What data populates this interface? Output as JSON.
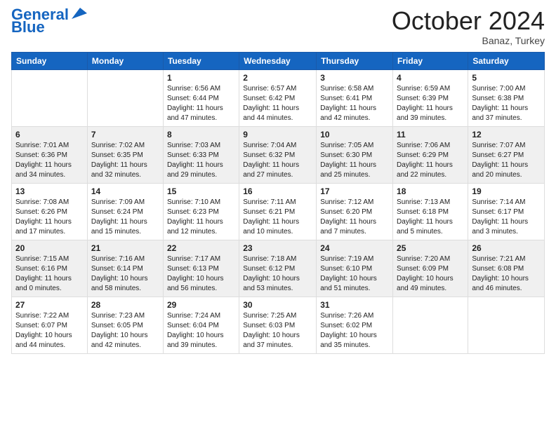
{
  "logo": {
    "line1": "General",
    "line2": "Blue"
  },
  "header": {
    "month": "October 2024",
    "location": "Banaz, Turkey"
  },
  "days_of_week": [
    "Sunday",
    "Monday",
    "Tuesday",
    "Wednesday",
    "Thursday",
    "Friday",
    "Saturday"
  ],
  "weeks": [
    [
      null,
      null,
      {
        "day": 1,
        "sunrise": "6:56 AM",
        "sunset": "6:44 PM",
        "daylight": "11 hours and 47 minutes."
      },
      {
        "day": 2,
        "sunrise": "6:57 AM",
        "sunset": "6:42 PM",
        "daylight": "11 hours and 44 minutes."
      },
      {
        "day": 3,
        "sunrise": "6:58 AM",
        "sunset": "6:41 PM",
        "daylight": "11 hours and 42 minutes."
      },
      {
        "day": 4,
        "sunrise": "6:59 AM",
        "sunset": "6:39 PM",
        "daylight": "11 hours and 39 minutes."
      },
      {
        "day": 5,
        "sunrise": "7:00 AM",
        "sunset": "6:38 PM",
        "daylight": "11 hours and 37 minutes."
      }
    ],
    [
      {
        "day": 6,
        "sunrise": "7:01 AM",
        "sunset": "6:36 PM",
        "daylight": "11 hours and 34 minutes."
      },
      {
        "day": 7,
        "sunrise": "7:02 AM",
        "sunset": "6:35 PM",
        "daylight": "11 hours and 32 minutes."
      },
      {
        "day": 8,
        "sunrise": "7:03 AM",
        "sunset": "6:33 PM",
        "daylight": "11 hours and 29 minutes."
      },
      {
        "day": 9,
        "sunrise": "7:04 AM",
        "sunset": "6:32 PM",
        "daylight": "11 hours and 27 minutes."
      },
      {
        "day": 10,
        "sunrise": "7:05 AM",
        "sunset": "6:30 PM",
        "daylight": "11 hours and 25 minutes."
      },
      {
        "day": 11,
        "sunrise": "7:06 AM",
        "sunset": "6:29 PM",
        "daylight": "11 hours and 22 minutes."
      },
      {
        "day": 12,
        "sunrise": "7:07 AM",
        "sunset": "6:27 PM",
        "daylight": "11 hours and 20 minutes."
      }
    ],
    [
      {
        "day": 13,
        "sunrise": "7:08 AM",
        "sunset": "6:26 PM",
        "daylight": "11 hours and 17 minutes."
      },
      {
        "day": 14,
        "sunrise": "7:09 AM",
        "sunset": "6:24 PM",
        "daylight": "11 hours and 15 minutes."
      },
      {
        "day": 15,
        "sunrise": "7:10 AM",
        "sunset": "6:23 PM",
        "daylight": "11 hours and 12 minutes."
      },
      {
        "day": 16,
        "sunrise": "7:11 AM",
        "sunset": "6:21 PM",
        "daylight": "11 hours and 10 minutes."
      },
      {
        "day": 17,
        "sunrise": "7:12 AM",
        "sunset": "6:20 PM",
        "daylight": "11 hours and 7 minutes."
      },
      {
        "day": 18,
        "sunrise": "7:13 AM",
        "sunset": "6:18 PM",
        "daylight": "11 hours and 5 minutes."
      },
      {
        "day": 19,
        "sunrise": "7:14 AM",
        "sunset": "6:17 PM",
        "daylight": "11 hours and 3 minutes."
      }
    ],
    [
      {
        "day": 20,
        "sunrise": "7:15 AM",
        "sunset": "6:16 PM",
        "daylight": "11 hours and 0 minutes."
      },
      {
        "day": 21,
        "sunrise": "7:16 AM",
        "sunset": "6:14 PM",
        "daylight": "10 hours and 58 minutes."
      },
      {
        "day": 22,
        "sunrise": "7:17 AM",
        "sunset": "6:13 PM",
        "daylight": "10 hours and 56 minutes."
      },
      {
        "day": 23,
        "sunrise": "7:18 AM",
        "sunset": "6:12 PM",
        "daylight": "10 hours and 53 minutes."
      },
      {
        "day": 24,
        "sunrise": "7:19 AM",
        "sunset": "6:10 PM",
        "daylight": "10 hours and 51 minutes."
      },
      {
        "day": 25,
        "sunrise": "7:20 AM",
        "sunset": "6:09 PM",
        "daylight": "10 hours and 49 minutes."
      },
      {
        "day": 26,
        "sunrise": "7:21 AM",
        "sunset": "6:08 PM",
        "daylight": "10 hours and 46 minutes."
      }
    ],
    [
      {
        "day": 27,
        "sunrise": "7:22 AM",
        "sunset": "6:07 PM",
        "daylight": "10 hours and 44 minutes."
      },
      {
        "day": 28,
        "sunrise": "7:23 AM",
        "sunset": "6:05 PM",
        "daylight": "10 hours and 42 minutes."
      },
      {
        "day": 29,
        "sunrise": "7:24 AM",
        "sunset": "6:04 PM",
        "daylight": "10 hours and 39 minutes."
      },
      {
        "day": 30,
        "sunrise": "7:25 AM",
        "sunset": "6:03 PM",
        "daylight": "10 hours and 37 minutes."
      },
      {
        "day": 31,
        "sunrise": "7:26 AM",
        "sunset": "6:02 PM",
        "daylight": "10 hours and 35 minutes."
      },
      null,
      null
    ]
  ]
}
